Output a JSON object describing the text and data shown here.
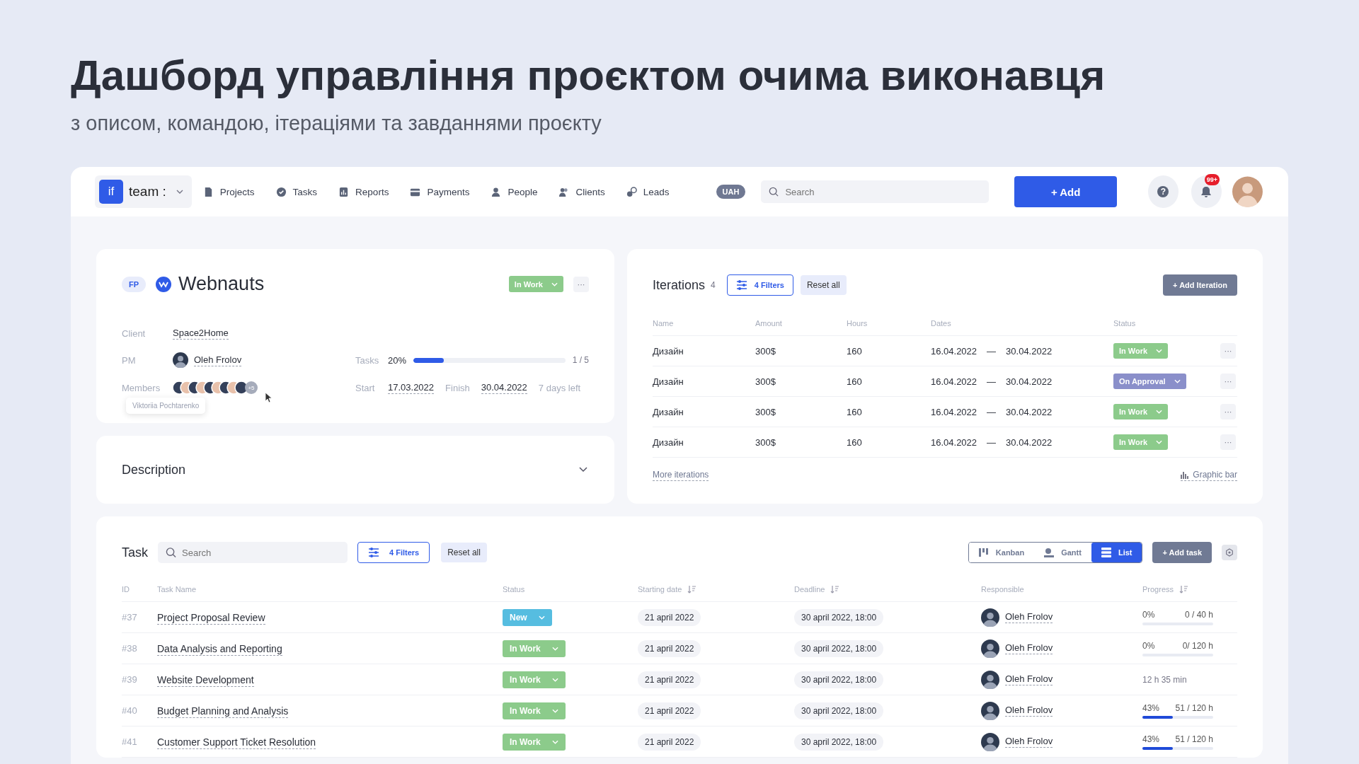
{
  "heading": "Дашборд управління проєктом очима виконавця",
  "subheading": "з описом, командою, ітераціями та завданнями проєкту",
  "nav": {
    "logo": "if",
    "team": "team :",
    "items": [
      {
        "label": "Projects",
        "kind": "file"
      },
      {
        "label": "Tasks",
        "kind": "check"
      },
      {
        "label": "Reports",
        "kind": "chart"
      },
      {
        "label": "Payments",
        "kind": "card"
      },
      {
        "label": "People",
        "kind": "person"
      },
      {
        "label": "Clients",
        "kind": "people"
      },
      {
        "label": "Leads",
        "kind": "leads"
      }
    ],
    "currency": "UAH",
    "search_placeholder": "Search",
    "add": "+ Add",
    "help": "?",
    "badge": "99+"
  },
  "project": {
    "badge": "FP",
    "name": "Webnauts",
    "status": {
      "label": "In Work",
      "kind": "in_work"
    },
    "more": "···",
    "client_label": "Client",
    "client": "Space2Home",
    "pm_label": "PM",
    "pm": "Oleh Frolov",
    "members_label": "Members",
    "members_more": "+5",
    "tooltip": "Viktoriia Pochtarenko",
    "tasks_label": "Tasks",
    "tasks_pct": "20%",
    "level": 0.2,
    "tasks_count": "1 / 5",
    "start_label": "Start",
    "start": "17.03.2022",
    "finish_label": "Finish",
    "finish": "30.04.2022",
    "days_left": "7 days left"
  },
  "description": {
    "title": "Description"
  },
  "iterations": {
    "title": "Iterations",
    "count": "4",
    "filters": "4 Filters",
    "reset": "Reset all",
    "add": "+ Add Iteration",
    "columns": [
      "Name",
      "Amount",
      "Hours",
      "Dates",
      "Status"
    ],
    "rows": [
      {
        "name": "Дизайн",
        "amount": "300$",
        "hours": "160",
        "start": "16.04.2022",
        "dash": "—",
        "end": "30.04.2022",
        "status": {
          "label": "In Work",
          "kind": "in_work"
        }
      },
      {
        "name": "Дизайн",
        "amount": "300$",
        "hours": "160",
        "start": "16.04.2022",
        "dash": "—",
        "end": "30.04.2022",
        "status": {
          "label": "On Approval",
          "kind": "on_approval"
        }
      },
      {
        "name": "Дизайн",
        "amount": "300$",
        "hours": "160",
        "start": "16.04.2022",
        "dash": "—",
        "end": "30.04.2022",
        "status": {
          "label": "In Work",
          "kind": "in_work"
        }
      },
      {
        "name": "Дизайн",
        "amount": "300$",
        "hours": "160",
        "start": "16.04.2022",
        "dash": "—",
        "end": "30.04.2022",
        "status": {
          "label": "In Work",
          "kind": "in_work"
        }
      }
    ],
    "row_more": "···",
    "more": "More iterations",
    "graphic": "Graphic bar"
  },
  "tasks": {
    "title": "Task",
    "search_placeholder": "Search",
    "filters": "4 Filters",
    "reset": "Reset all",
    "views": [
      {
        "label": "Kanban",
        "kind": "kanban",
        "selected": false
      },
      {
        "label": "Gantt",
        "kind": "gantt",
        "selected": false
      },
      {
        "label": "List",
        "kind": "list",
        "selected": true
      }
    ],
    "add": "+ Add task",
    "columns": [
      {
        "label": "ID",
        "sortable": false
      },
      {
        "label": "Task Name",
        "sortable": false
      },
      {
        "label": "Status",
        "sortable": false
      },
      {
        "label": "Starting date",
        "sortable": true
      },
      {
        "label": "Deadline",
        "sortable": true
      },
      {
        "label": "Responsible",
        "sortable": false
      },
      {
        "label": "Progress",
        "sortable": true
      }
    ],
    "rows": [
      {
        "id": "#37",
        "name": "Project Proposal Review",
        "status": {
          "label": "New",
          "kind": "new"
        },
        "start": "21 april 2022",
        "deadline": "30 april 2022, 18:00",
        "responsible": "Oleh Frolov",
        "progress": {
          "kind": "bar",
          "pct": "0%",
          "hours": "0 / 40 h",
          "level": 0
        }
      },
      {
        "id": "#38",
        "name": "Data Analysis and Reporting",
        "status": {
          "label": "In Work",
          "kind": "in_work"
        },
        "start": "21 april 2022",
        "deadline": "30 april 2022, 18:00",
        "responsible": "Oleh Frolov",
        "progress": {
          "kind": "bar",
          "pct": "0%",
          "hours": "0/ 120 h",
          "level": 0
        }
      },
      {
        "id": "#39",
        "name": "Website Development",
        "status": {
          "label": "In Work",
          "kind": "in_work"
        },
        "start": "21 april 2022",
        "deadline": "30 april 2022, 18:00",
        "responsible": "Oleh Frolov",
        "progress": {
          "kind": "time",
          "text": "12 h 35 min"
        }
      },
      {
        "id": "#40",
        "name": "Budget Planning and Analysis",
        "status": {
          "label": "In Work",
          "kind": "in_work"
        },
        "start": "21 april 2022",
        "deadline": "30 april 2022, 18:00",
        "responsible": "Oleh Frolov",
        "progress": {
          "kind": "bar",
          "pct": "43%",
          "hours": "51 / 120 h",
          "level": 0.43
        }
      },
      {
        "id": "#41",
        "name": "Customer Support Ticket Resolution",
        "status": {
          "label": "In Work",
          "kind": "in_work"
        },
        "start": "21 april 2022",
        "deadline": "30 april 2022, 18:00",
        "responsible": "Oleh Frolov",
        "progress": {
          "kind": "bar",
          "pct": "43%",
          "hours": "51 / 120 h",
          "level": 0.43
        }
      }
    ]
  }
}
